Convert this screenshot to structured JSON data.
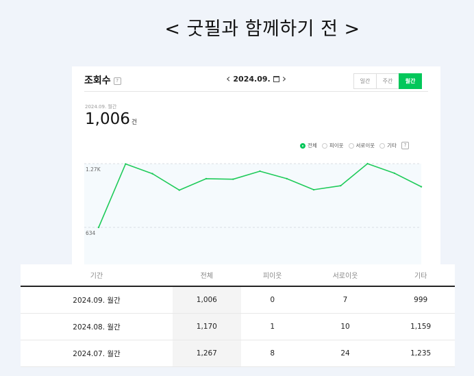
{
  "page_title": "< 굿필과 함께하기 전 >",
  "header": {
    "title": "조회수",
    "help_glyph": "?",
    "month": "2024.09.",
    "segments": [
      "일간",
      "주간",
      "월간"
    ],
    "active_segment": "월간"
  },
  "summary": {
    "subtitle": "2024.09. 월간",
    "value": "1,006",
    "unit": "건"
  },
  "legend": {
    "items": [
      "전체",
      "피이웃",
      "서로이웃",
      "기타"
    ],
    "selected": "전체",
    "help_glyph": "?"
  },
  "colors": {
    "accent": "#03c75a",
    "line": "#1fcb5a"
  },
  "chart_data": {
    "type": "line",
    "series": [
      {
        "values": [
          634,
          1267,
          1170,
          1006,
          1120,
          1115,
          1195,
          1120,
          1010,
          1050,
          1270,
          1175,
          1040
        ]
      }
    ],
    "y_ticks": [
      "1.27K",
      "634"
    ],
    "ylim": [
      634,
      1270
    ],
    "grid": true
  },
  "table": {
    "headers": [
      "기간",
      "전체",
      "피이웃",
      "서로이웃",
      "기타"
    ],
    "rows": [
      [
        "2024.09. 월간",
        "1,006",
        "0",
        "7",
        "999"
      ],
      [
        "2024.08. 월간",
        "1,170",
        "1",
        "10",
        "1,159"
      ],
      [
        "2024.07. 월간",
        "1,267",
        "8",
        "24",
        "1,235"
      ]
    ]
  }
}
